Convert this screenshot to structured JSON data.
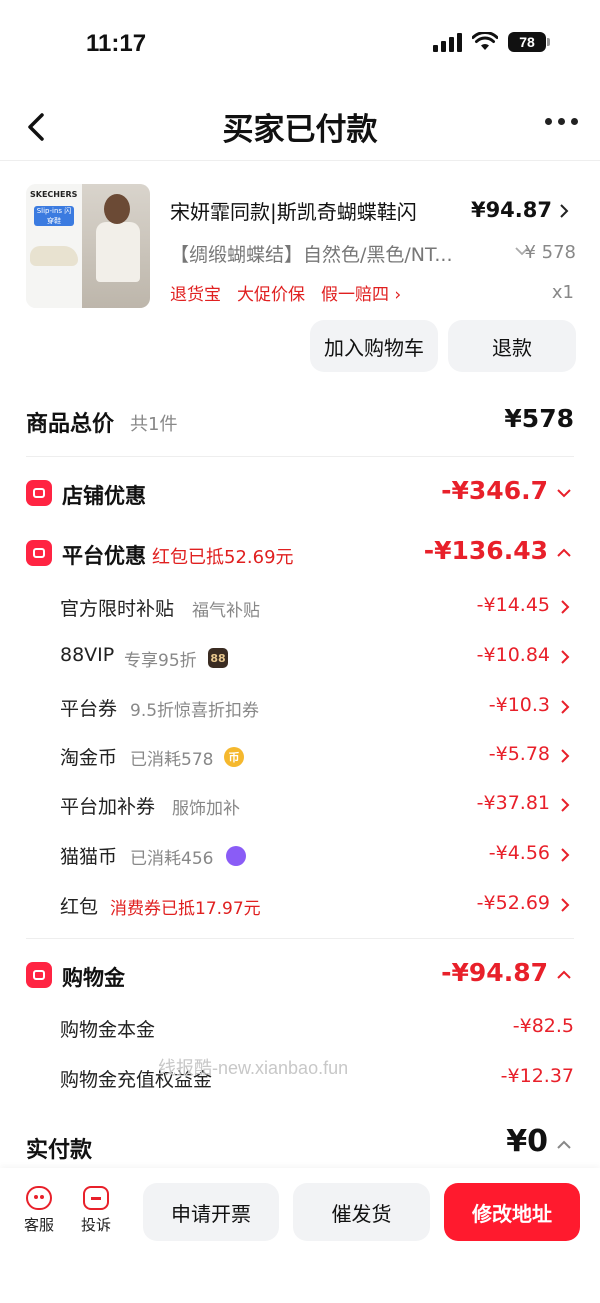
{
  "status_bar": {
    "time": "11:17",
    "battery": "78"
  },
  "nav": {
    "title": "买家已付款"
  },
  "product": {
    "name": "宋妍霏同款|斯凯奇蝴蝶鞋闪",
    "price": "¥94.87",
    "spec": "【绸缎蝴蝶结】自然色/黑色/NT...",
    "original_price": "¥ 578",
    "quantity": "x1",
    "services": [
      "退货宝",
      "大促价保",
      "假一赔四"
    ],
    "thumb_brand": "SKECHERS",
    "thumb_tag": "Slip-ins 闪穿鞋"
  },
  "actions": {
    "add_to_cart": "加入购物车",
    "refund": "退款"
  },
  "total": {
    "label": "商品总价",
    "count": "共1件",
    "amount": "¥578"
  },
  "store_discount": {
    "label": "店铺优惠",
    "amount": "-¥346.7"
  },
  "platform_discount": {
    "label": "平台优惠",
    "note": "红包已抵52.69元",
    "amount": "-¥136.43",
    "items": [
      {
        "label": "官方限时补贴",
        "note": "福气补贴",
        "amount": "-¥14.45"
      },
      {
        "label": "88VIP",
        "note": "专享95折",
        "badge": "88",
        "amount": "-¥10.84"
      },
      {
        "label": "平台券",
        "note": "9.5折惊喜折扣券",
        "amount": "-¥10.3"
      },
      {
        "label": "淘金币",
        "note": "已消耗578",
        "badge": "币",
        "amount": "-¥5.78"
      },
      {
        "label": "平台加补券",
        "note": "服饰加补",
        "amount": "-¥37.81"
      },
      {
        "label": "猫猫币",
        "note": "已消耗456",
        "amount": "-¥4.56"
      },
      {
        "label": "红包",
        "note": "消费券已抵17.97元",
        "amount": "-¥52.69"
      }
    ]
  },
  "shopping_gold": {
    "label": "购物金",
    "amount": "-¥94.87",
    "items": [
      {
        "label": "购物金本金",
        "amount": "-¥82.5"
      },
      {
        "label": "购物金充值权益金",
        "amount": "-¥12.37"
      }
    ]
  },
  "watermark": "线报酷-new.xianbao.fun",
  "paid": {
    "label": "实付款",
    "amount": "¥0"
  },
  "bottom": {
    "service": "客服",
    "complain": "投诉",
    "invoice": "申请开票",
    "urge": "催发货",
    "change_address": "修改地址"
  },
  "colors": {
    "accent_red": "#e8202a",
    "button_red": "#ff1a2e",
    "button_gray": "#f2f3f5"
  }
}
